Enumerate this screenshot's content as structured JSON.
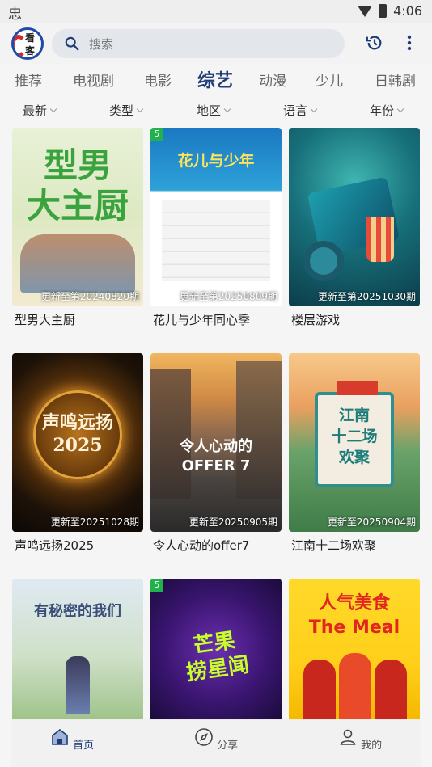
{
  "status": {
    "left_icon": "忠",
    "time": "4:06",
    "icons": [
      "wifi-icon",
      "battery-icon"
    ]
  },
  "app": {
    "logo_text": "看客"
  },
  "search": {
    "placeholder": "搜索"
  },
  "categories": [
    "推荐",
    "电视剧",
    "电影",
    "综艺",
    "动漫",
    "少儿",
    "日韩剧"
  ],
  "active_category": "综艺",
  "filters": [
    "最新",
    "类型",
    "地区",
    "语言",
    "年份"
  ],
  "cards": [
    {
      "title": "型男大主厨",
      "update": "更新至第20240820期",
      "badge": "",
      "art": "型男\n大主厨"
    },
    {
      "title": "花儿与少年同心季",
      "update": "更新至第20250809期",
      "badge": "5",
      "art": "花儿与少年"
    },
    {
      "title": "楼层游戏",
      "update": "更新至第20251030期",
      "badge": "",
      "art": ""
    },
    {
      "title": "声鸣远扬2025",
      "update": "更新至20251028期",
      "badge": "",
      "art": "声鸣远扬\n2025"
    },
    {
      "title": "令人心动的offer7",
      "update": "更新至20250905期",
      "badge": "",
      "art": "令人心动的\nOFFER 7"
    },
    {
      "title": "江南十二场欢聚",
      "update": "更新至20250904期",
      "badge": "",
      "art": "江南\n十二场\n欢聚"
    },
    {
      "title": "",
      "update": "",
      "badge": "",
      "art": "有秘密的我们"
    },
    {
      "title": "",
      "update": "",
      "badge": "5",
      "art": "芒果\n捞星闻"
    },
    {
      "title": "",
      "update": "",
      "badge": "",
      "art": "人气美食\nThe Meal"
    }
  ],
  "bottom_nav": [
    {
      "label": "首页",
      "icon": "home-icon",
      "active": true
    },
    {
      "label": "分享",
      "icon": "compass-icon",
      "active": false
    },
    {
      "label": "我的",
      "icon": "user-icon",
      "active": false
    }
  ],
  "colors": {
    "accent": "#1f3c77",
    "badge": "#22b24c",
    "search_bg": "#e3e6eb"
  }
}
